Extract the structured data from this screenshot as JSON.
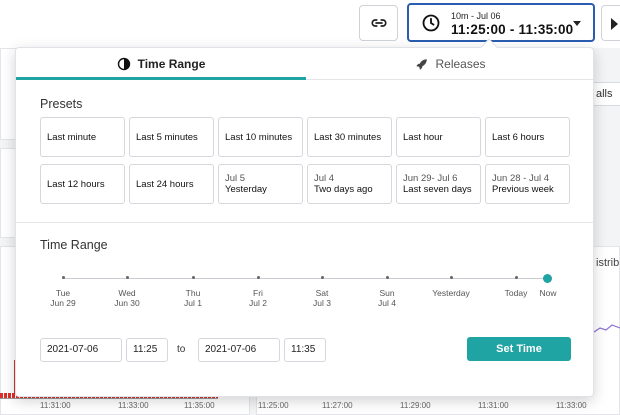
{
  "topbar": {
    "range_small": "10m - Jul 06",
    "range_big": "11:25:00 - 11:35:00"
  },
  "background": {
    "side_tab": "alls",
    "right_label": "istrib",
    "left_ticks": [
      "11:31:00",
      "11:33:00",
      "11:35:00"
    ],
    "right_ticks": [
      "11:25:00",
      "11:27:00",
      "11:29:00",
      "11:31:00",
      "11:33:00"
    ]
  },
  "popover": {
    "tabs": [
      {
        "label": "Time Range",
        "icon": "half-moon-icon",
        "active": true
      },
      {
        "label": "Releases",
        "icon": "rocket-icon",
        "active": false
      }
    ],
    "presets_title": "Presets",
    "presets": [
      {
        "main": "Last minute",
        "sub": ""
      },
      {
        "main": "Last 5 minutes",
        "sub": ""
      },
      {
        "main": "Last 10 minutes",
        "sub": ""
      },
      {
        "main": "Last 30 minutes",
        "sub": ""
      },
      {
        "main": "Last hour",
        "sub": ""
      },
      {
        "main": "Last 6 hours",
        "sub": ""
      },
      {
        "main": "Last 12 hours",
        "sub": ""
      },
      {
        "main": "Last 24 hours",
        "sub": ""
      },
      {
        "sub": "Jul 5",
        "main": "Yesterday"
      },
      {
        "sub": "Jul 4",
        "main": "Two days ago"
      },
      {
        "sub": "Jun 29- Jul 6",
        "main": "Last seven days"
      },
      {
        "sub": "Jun 28 - Jul 4",
        "main": "Previous week"
      }
    ],
    "time_range_title": "Time Range",
    "timeline": [
      {
        "line1": "Tue",
        "line2": "Jun 29"
      },
      {
        "line1": "Wed",
        "line2": "Jun 30"
      },
      {
        "line1": "Thu",
        "line2": "Jul 1"
      },
      {
        "line1": "Fri",
        "line2": "Jul 2"
      },
      {
        "line1": "Sat",
        "line2": "Jul 3"
      },
      {
        "line1": "Sun",
        "line2": "Jul 4"
      },
      {
        "line1": "Yesterday",
        "line2": ""
      },
      {
        "line1": "Today",
        "line2": ""
      },
      {
        "line1": "Now",
        "line2": ""
      }
    ],
    "from_date": "2021-07-06",
    "from_time": "11:25",
    "to_label": "to",
    "to_date": "2021-07-06",
    "to_time": "11:35",
    "set_button": "Set Time"
  },
  "colors": {
    "accent": "#1fa3a3",
    "selected_border": "#2a5db0",
    "error_red": "#d9302c"
  }
}
